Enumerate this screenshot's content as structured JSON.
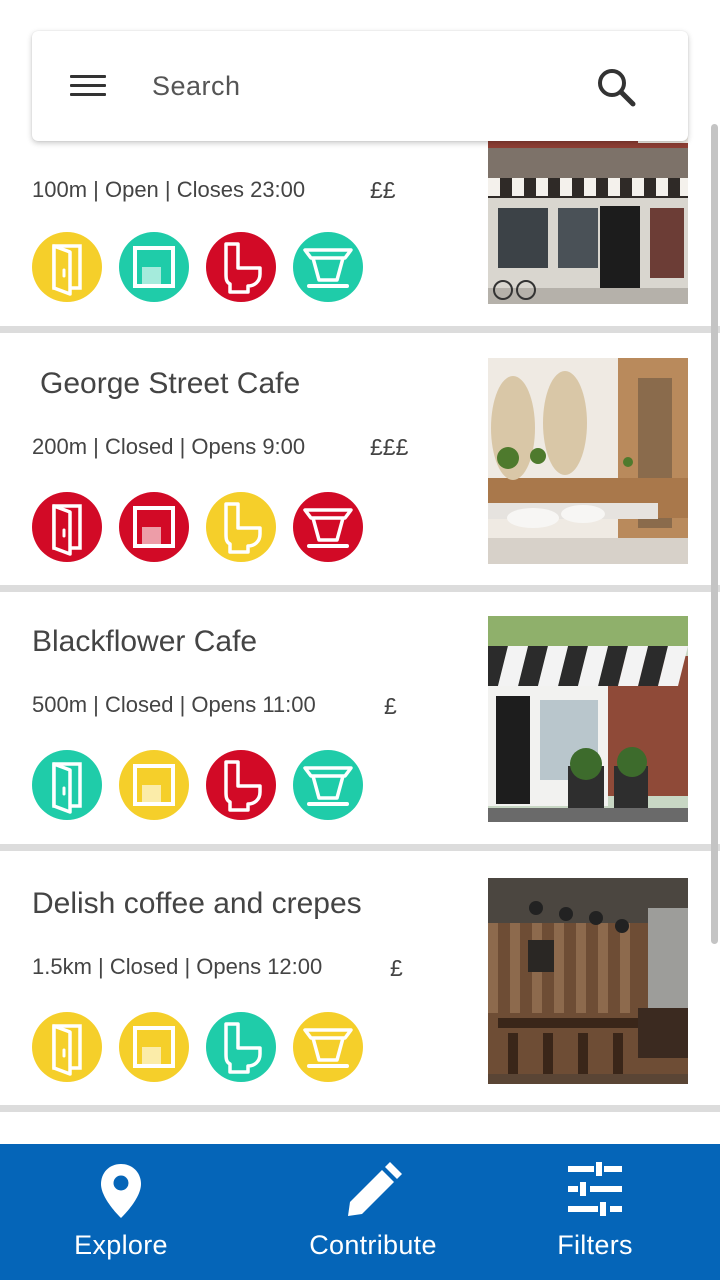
{
  "search": {
    "placeholder": "Search"
  },
  "colors": {
    "yellow": "#f5cf2a",
    "teal": "#1fcca9",
    "red": "#d20a26",
    "nav_bg": "#0565b8"
  },
  "cards": [
    {
      "name": "",
      "distance": "100m",
      "status": "Open",
      "hours": "Closes 23:00",
      "meta": "100m | Open | Closes 23:00",
      "price": "££",
      "features": {
        "entrance": "yellow",
        "space": "teal",
        "toilet": "red",
        "cafe": "teal"
      }
    },
    {
      "name": "George Street Cafe",
      "distance": "200m",
      "status": "Closed",
      "hours": "Opens 9:00",
      "meta": "200m | Closed | Opens 9:00",
      "price": "£££",
      "features": {
        "entrance": "red",
        "space": "red",
        "toilet": "yellow",
        "cafe": "red"
      }
    },
    {
      "name": "Blackflower Cafe",
      "distance": "500m",
      "status": "Closed",
      "hours": "Opens 11:00",
      "meta": "500m | Closed | Opens 11:00",
      "price": "£",
      "features": {
        "entrance": "teal",
        "space": "yellow",
        "toilet": "red",
        "cafe": "teal"
      }
    },
    {
      "name": "Delish coffee and crepes",
      "distance": "1.5km",
      "status": "Closed",
      "hours": "Opens 12:00",
      "meta": "1.5km | Closed | Opens 12:00",
      "price": "£",
      "features": {
        "entrance": "yellow",
        "space": "yellow",
        "toilet": "teal",
        "cafe": "yellow"
      }
    }
  ],
  "nav": {
    "explore": {
      "label": "Explore",
      "icon": "location-pin-icon"
    },
    "contribute": {
      "label": "Contribute",
      "icon": "pencil-icon"
    },
    "filters": {
      "label": "Filters",
      "icon": "sliders-icon"
    }
  }
}
